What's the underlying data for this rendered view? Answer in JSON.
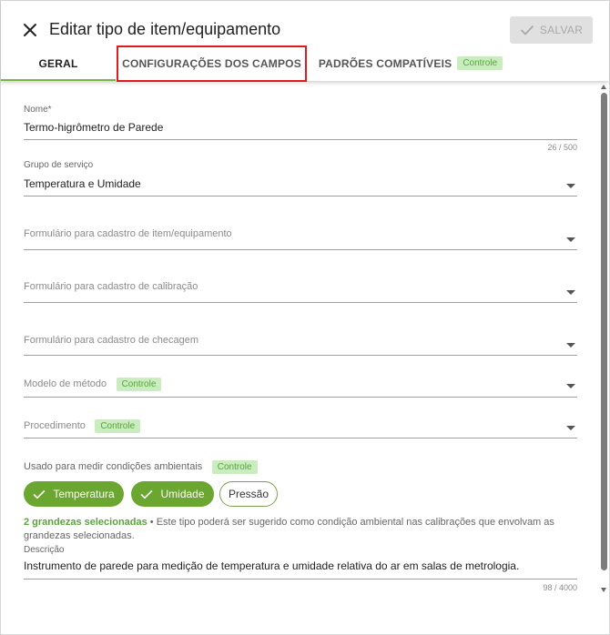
{
  "header": {
    "title": "Editar tipo de item/equipamento",
    "save_label": "SALVAR"
  },
  "tabs": [
    {
      "label": "GERAL",
      "active": true
    },
    {
      "label": "CONFIGURAÇÕES DOS CAMPOS",
      "active": false
    },
    {
      "label": "PADRÕES COMPATÍVEIS",
      "badge": "Controle",
      "active": false
    }
  ],
  "form": {
    "name": {
      "label": "Nome*",
      "value": "Termo-higrômetro de Parede",
      "counter": "26 / 500"
    },
    "service_group": {
      "label": "Grupo de serviço",
      "value": "Temperatura e Umidade"
    },
    "item_form": {
      "placeholder": "Formulário para cadastro de item/equipamento"
    },
    "calibration_form": {
      "placeholder": "Formulário para cadastro de calibração"
    },
    "check_form": {
      "placeholder": "Formulário para cadastro de checagem"
    },
    "method_model": {
      "placeholder": "Modelo de método",
      "badge": "Controle"
    },
    "procedure": {
      "placeholder": "Procedimento",
      "badge": "Controle"
    },
    "ambient": {
      "label": "Usado para medir condições ambientais",
      "badge": "Controle",
      "chips": [
        {
          "label": "Temperatura",
          "selected": true
        },
        {
          "label": "Umidade",
          "selected": true
        },
        {
          "label": "Pressão",
          "selected": false
        }
      ],
      "helper_strong": "2 grandezas selecionadas",
      "helper_text": " • Este tipo poderá ser sugerido como condição ambiental nas calibrações que envolvam as grandezas selecionadas."
    },
    "description": {
      "label": "Descrição",
      "value": "Instrumento de parede para medição de temperatura e umidade relativa do ar em salas de metrologia.",
      "counter": "98 / 4000"
    }
  },
  "colors": {
    "accent_green": "#6aa630",
    "badge_bg": "#c9edbf",
    "highlight_red": "#e11b1b"
  },
  "icons": {
    "close": "close-icon",
    "check": "check-icon",
    "dropdown": "chevron-down-icon"
  }
}
